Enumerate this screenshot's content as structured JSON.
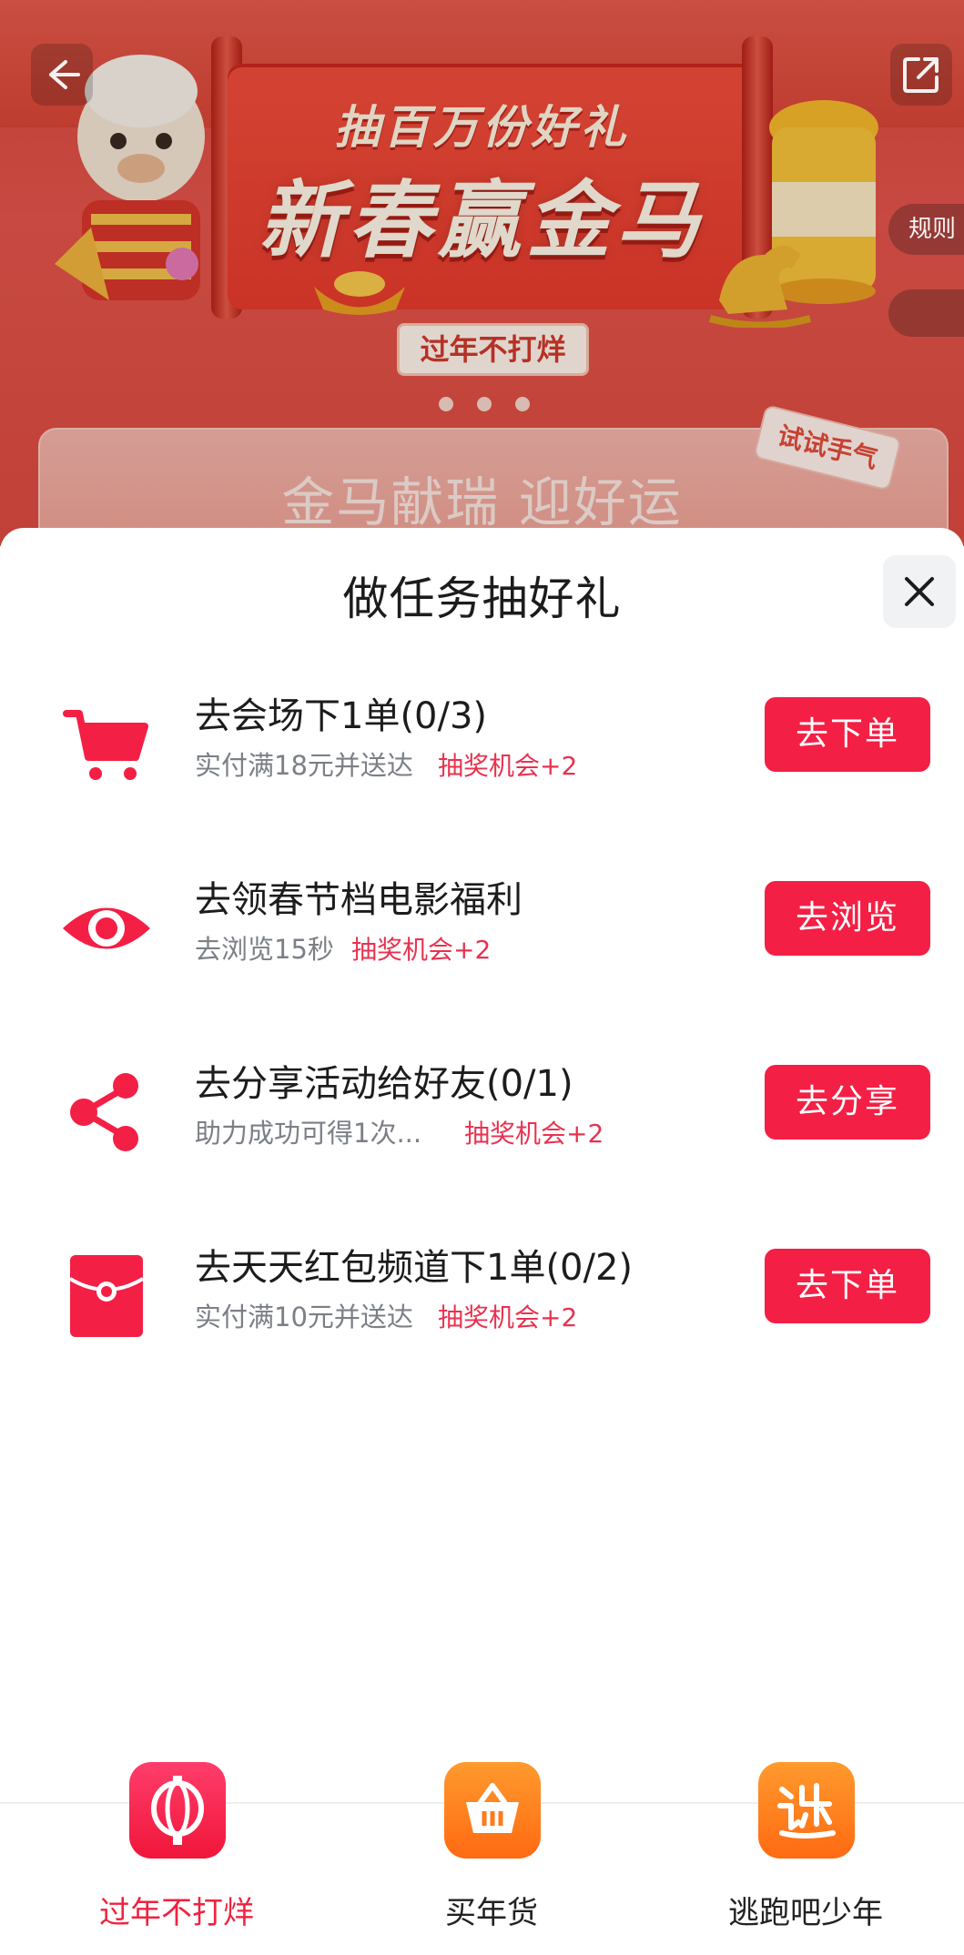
{
  "banner": {
    "sub_title": "抽百万份好礼",
    "main_title": "新春赢金马",
    "tag": "过年不打烊",
    "card_text": "金马献瑞 迎好运",
    "trial_tag": "试试手气",
    "rule_label": "规则"
  },
  "sheet": {
    "title": "做任务抽好礼",
    "tasks": [
      {
        "icon": "cart-icon",
        "title": "去会场下1单(0/3)",
        "desc": "实付满18元并送达",
        "reward": "抽奖机会+2",
        "button": "去下单"
      },
      {
        "icon": "eye-icon",
        "title": "去领春节档电影福利",
        "desc": "去浏览15秒",
        "reward": "抽奖机会+2",
        "button": "去浏览"
      },
      {
        "icon": "share-icon",
        "title": "去分享活动给好友(0/1)",
        "desc": "助力成功可得1次...",
        "reward": "抽奖机会+2",
        "button": "去分享"
      },
      {
        "icon": "red-envelope-icon",
        "title": "去天天红包频道下1单(0/2)",
        "desc": "实付满10元并送达",
        "reward": "抽奖机会+2",
        "button": "去下单"
      }
    ]
  },
  "nav": {
    "items": [
      {
        "label": "过年不打烊",
        "icon": "lantern-icon",
        "active": true
      },
      {
        "label": "买年货",
        "icon": "basket-icon",
        "active": false
      },
      {
        "label": "逃跑吧少年",
        "icon": "escape-icon",
        "active": false
      }
    ]
  },
  "colors": {
    "accent": "#f41f45",
    "banner_red": "#e3544a",
    "nav_orange": "#ff7a1a"
  }
}
